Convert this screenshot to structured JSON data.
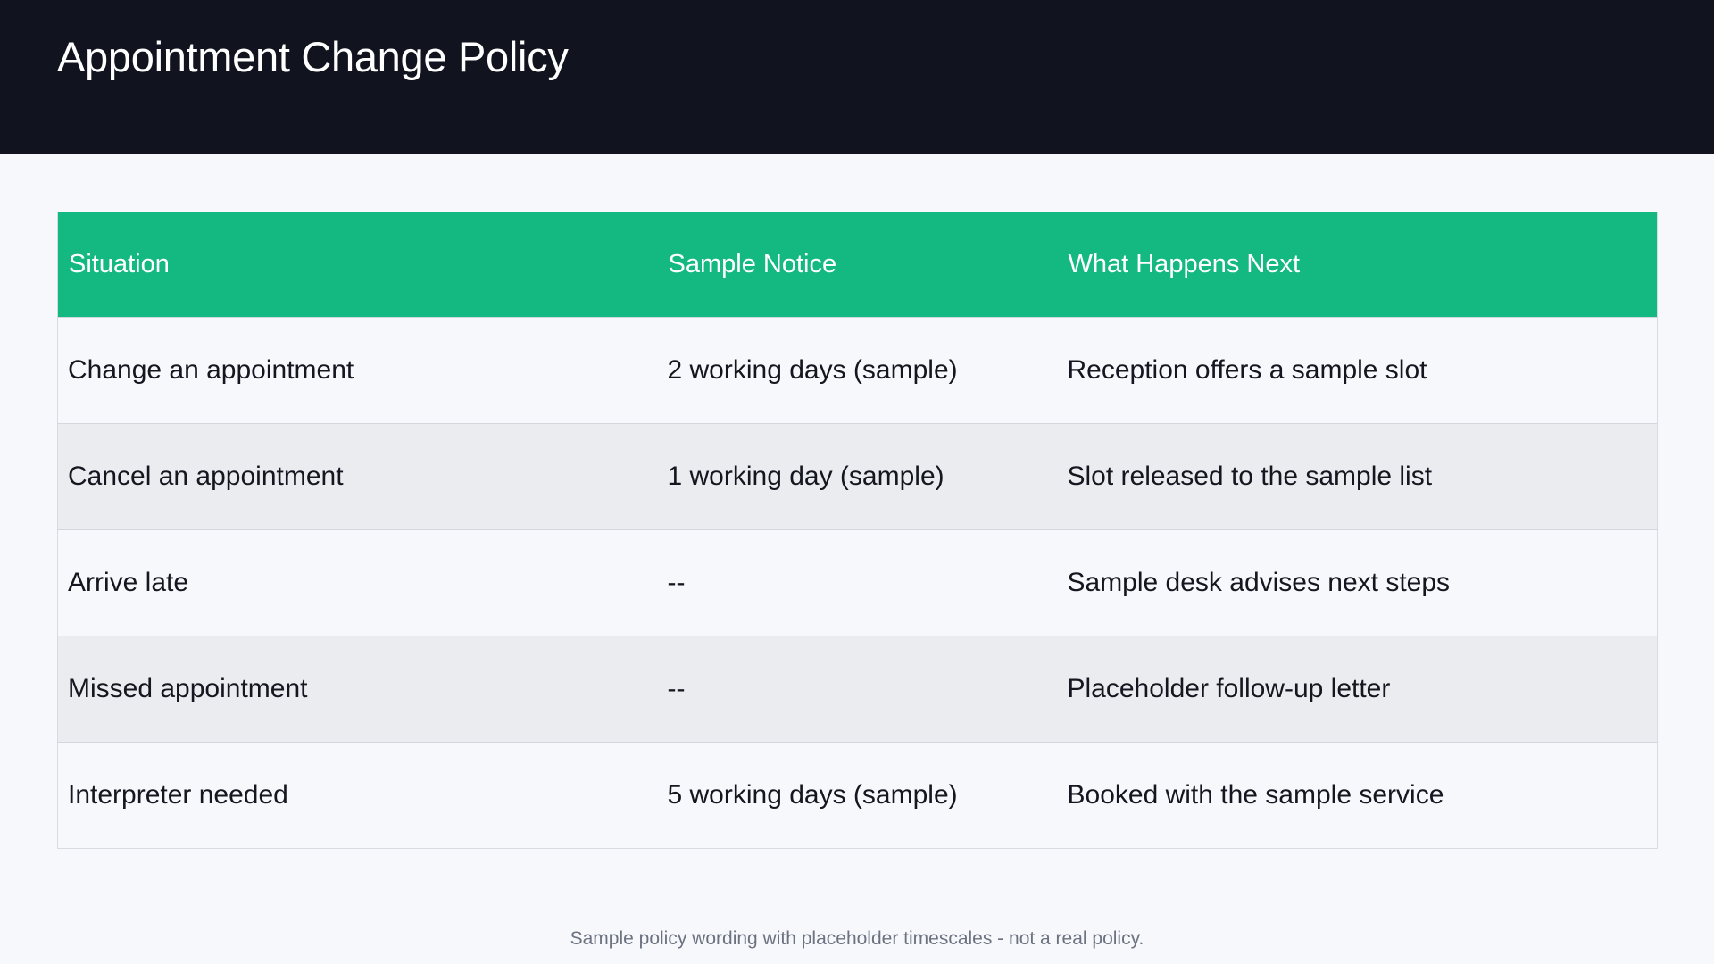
{
  "header": {
    "title": "Appointment Change Policy",
    "background_color": "#11141f"
  },
  "table": {
    "header_color": "#14b981",
    "columns": [
      "Situation",
      "Sample Notice",
      "What Happens Next"
    ],
    "rows": [
      [
        "Change an appointment",
        "2 working days (sample)",
        "Reception offers a sample slot"
      ],
      [
        "Cancel an appointment",
        "1 working day (sample)",
        "Slot released to the sample list"
      ],
      [
        "Arrive late",
        "--",
        "Sample desk advises next steps"
      ],
      [
        "Missed appointment",
        "--",
        "Placeholder follow-up letter"
      ],
      [
        "Interpreter needed",
        "5 working days (sample)",
        "Booked with the sample service"
      ]
    ]
  },
  "footer": {
    "note": "Sample policy wording with placeholder timescales - not a real policy."
  }
}
